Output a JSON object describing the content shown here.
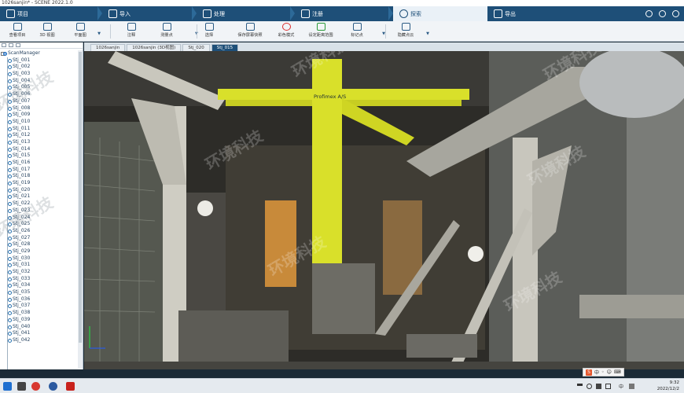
{
  "window": {
    "title": "1026sanjin* - SCENE 2022.1.0"
  },
  "modes": [
    {
      "label": "项目",
      "icon": "folder-icon"
    },
    {
      "label": "导入",
      "icon": "import-icon"
    },
    {
      "label": "处理",
      "icon": "process-icon"
    },
    {
      "label": "注册",
      "icon": "register-icon"
    },
    {
      "label": "探索",
      "icon": "explore-icon",
      "active": true
    },
    {
      "label": "导出",
      "icon": "export-icon"
    }
  ],
  "toolbar": {
    "items": [
      {
        "label": "查看项目",
        "icon": "project-view-icon"
      },
      {
        "label": "3D 视图",
        "icon": "3d-view-icon"
      },
      {
        "label": "平面图",
        "icon": "planview-icon"
      },
      {
        "label": "注释",
        "icon": "annotation-icon"
      },
      {
        "label": "测量点",
        "icon": "measure-icon"
      },
      {
        "label": "选择",
        "icon": "select-icon"
      },
      {
        "label": "保存屏幕快照",
        "icon": "snapshot-icon"
      },
      {
        "label": "彩色模式",
        "icon": "color-mode-icon"
      },
      {
        "label": "设定距离范围",
        "icon": "distance-range-icon"
      },
      {
        "label": "标记点",
        "icon": "marker-icon"
      },
      {
        "label": "隐藏点云",
        "icon": "hide-cloud-icon"
      }
    ]
  },
  "sidebar": {
    "root": "ScanManager",
    "items": [
      "Stj_001",
      "Stj_002",
      "Stj_003",
      "Stj_004",
      "Stj_005",
      "Stj_006",
      "Stj_007",
      "Stj_008",
      "Stj_009",
      "Stj_010",
      "Stj_011",
      "Stj_012",
      "Stj_013",
      "Stj_014",
      "Stj_015",
      "Stj_016",
      "Stj_017",
      "Stj_018",
      "Stj_019",
      "Stj_020",
      "Stj_021",
      "Stj_022",
      "Stj_023",
      "Stj_024",
      "Stj_025",
      "Stj_026",
      "Stj_027",
      "Stj_028",
      "Stj_029",
      "Stj_030",
      "Stj_031",
      "Stj_032",
      "Stj_033",
      "Stj_034",
      "Stj_035",
      "Stj_036",
      "Stj_037",
      "Stj_038",
      "Stj_039",
      "Stj_040",
      "Stj_041",
      "Stj_042"
    ]
  },
  "doc_tabs": [
    {
      "label": "1026sanjin"
    },
    {
      "label": "1026sanjin (3D视图)"
    },
    {
      "label": "Stj_020"
    },
    {
      "label": "Stj_015",
      "active": true
    }
  ],
  "viewport": {
    "crane_label": "Profimex A/S"
  },
  "watermark": {
    "text": "环境科技"
  },
  "ime": {
    "lang": "中",
    "brand": "S"
  },
  "taskbar": {
    "time": "9:32",
    "date": "2022/12/2",
    "tray_lang": "中"
  },
  "colors": {
    "accent": "#1e4f78",
    "crane": "#d9e02a"
  }
}
